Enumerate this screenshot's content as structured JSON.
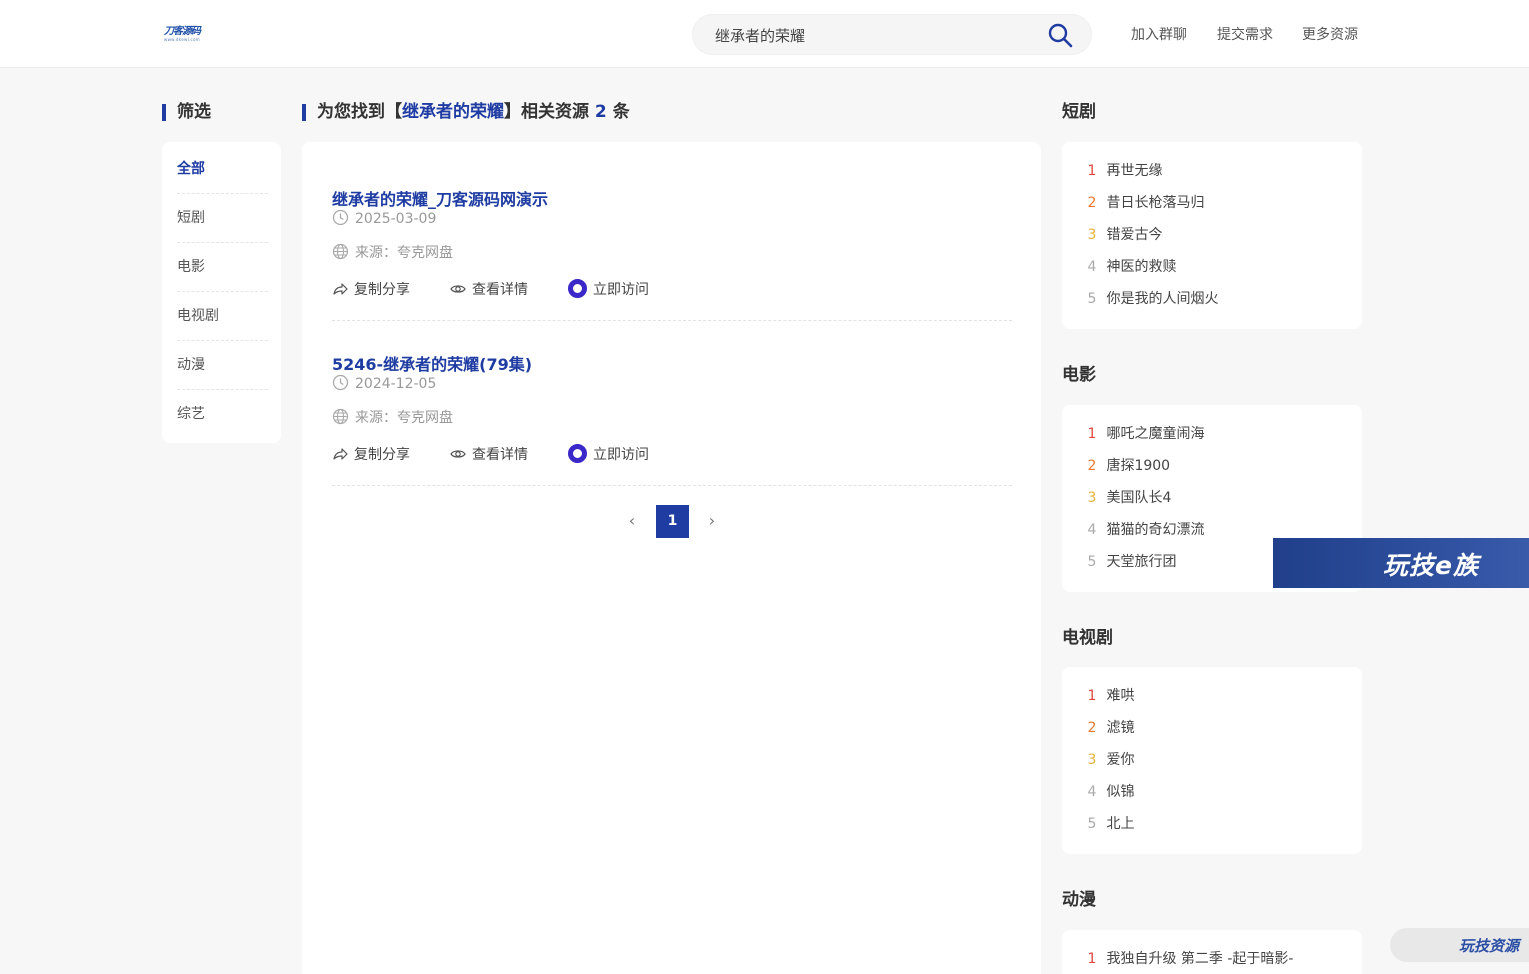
{
  "header": {
    "logo_text": "刀客源码",
    "logo_sub": "www.dkewl.com",
    "search_value": "继承者的荣耀",
    "nav": [
      "加入群聊",
      "提交需求",
      "更多资源"
    ]
  },
  "filter": {
    "title": "筛选",
    "items": [
      "全部",
      "短剧",
      "电影",
      "电视剧",
      "动漫",
      "综艺"
    ],
    "active": "全部"
  },
  "results": {
    "summary_prefix": "为您找到【",
    "keyword": "继承者的荣耀",
    "summary_mid": "】相关资源",
    "count": "2",
    "summary_suffix": "条",
    "items": [
      {
        "title": "继承者的荣耀_刀客源码网演示",
        "date": "2025-03-09",
        "source": "来源：夸克网盘",
        "actions": [
          "复制分享",
          "查看详情",
          "立即访问"
        ]
      },
      {
        "title": "5246-继承者的荣耀(79集)",
        "date": "2024-12-05",
        "source": "来源：夸克网盘",
        "actions": [
          "复制分享",
          "查看详情",
          "立即访问"
        ]
      }
    ],
    "pagination": {
      "prev": "‹",
      "current": "1",
      "next": "›"
    }
  },
  "sidebar": {
    "sections": [
      {
        "title": "短剧",
        "items": [
          "再世无缘",
          "昔日长枪落马归",
          "错爱古今",
          "神医的救赎",
          "你是我的人间烟火"
        ]
      },
      {
        "title": "电影",
        "items": [
          "哪吒之魔童闹海",
          "唐探1900",
          "美国队长4",
          "猫猫的奇幻漂流",
          "天堂旅行团"
        ]
      },
      {
        "title": "电视剧",
        "items": [
          "难哄",
          "滤镜",
          "爱你",
          "似锦",
          "北上"
        ]
      },
      {
        "title": "动漫",
        "items": [
          "我独自升级 第二季 -起于暗影-"
        ]
      }
    ]
  },
  "rank_colors": [
    "#e0473b",
    "#e8792f",
    "#e6b23a",
    "#aaaaaa",
    "#aaaaaa"
  ],
  "overlays": {
    "banner": "玩技e族",
    "badge": "玩技资源"
  },
  "accent": "#1f3ca3"
}
